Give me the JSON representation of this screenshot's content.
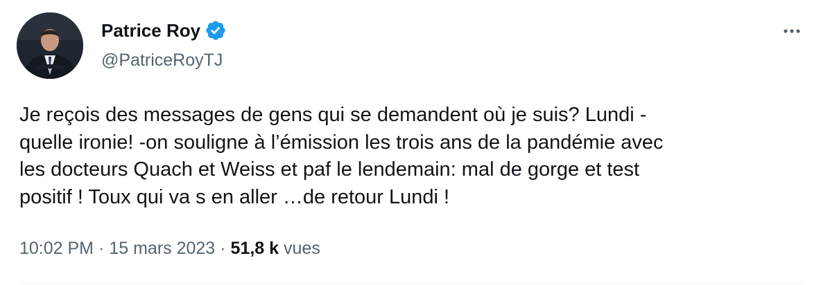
{
  "author": {
    "display_name": "Patrice Roy",
    "handle": "@PatriceRoyTJ",
    "verified_icon": "verified-badge-icon",
    "avatar_icon": "avatar"
  },
  "actions": {
    "more_icon": "more-options-icon"
  },
  "tweet": {
    "text": "Je reçois des messages de gens qui se demandent où je suis?  Lundi -\nquelle ironie! -on souligne à l’émission les trois ans de la pandémie avec\nles docteurs Quach et Weiss et paf le lendemain: mal de gorge et test\npositif ! Toux qui va s en aller …de retour Lundi !"
  },
  "meta": {
    "time": "10:02 PM",
    "separator": "·",
    "date": "15 mars 2023",
    "views_count": "51,8 k",
    "views_label": "vues"
  },
  "colors": {
    "text": "#0f1419",
    "secondary": "#536471",
    "verified": "#1d9bf0",
    "divider": "#eff3f4"
  }
}
